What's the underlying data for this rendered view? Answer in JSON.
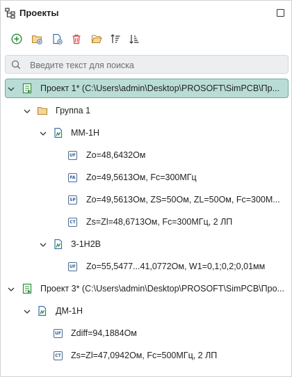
{
  "panel": {
    "title": "Проекты",
    "title_icon": "project-tree-icon",
    "maximize_icon": "maximize-icon"
  },
  "toolbar": {
    "buttons": [
      {
        "icon": "add-circle-icon",
        "color": "#2e8b3a"
      },
      {
        "icon": "new-folder-icon",
        "color": "#c79a3c"
      },
      {
        "icon": "new-file-icon",
        "color": "#3d6fb0"
      },
      {
        "icon": "delete-icon",
        "color": "#d64545"
      },
      {
        "icon": "open-folder-icon",
        "color": "#c79a3c"
      },
      {
        "icon": "sort-ascending-icon",
        "color": "#333333"
      },
      {
        "icon": "sort-descending-icon",
        "color": "#333333"
      }
    ]
  },
  "search": {
    "placeholder": "Введите текст для поиска"
  },
  "tree": {
    "rows": [
      {
        "text": "Проект 1* (C:\\Users\\admin\\Desktop\\PROSOFT\\SimPCB\\Пр...",
        "type": "project",
        "selected": true
      },
      {
        "text": "Группа 1",
        "type": "group"
      },
      {
        "text": "ММ-1Н",
        "type": "model"
      },
      {
        "text": "Zo=48,6432Ом",
        "type": "result",
        "badge": "UF"
      },
      {
        "text": "Zo=49,5613Ом, Fc=300МГц",
        "type": "result",
        "badge": "FA"
      },
      {
        "text": "Zo=49,5613Ом, ZS=50Ом, ZL=50Ом, Fc=300М...",
        "type": "result",
        "badge": "SP"
      },
      {
        "text": "Zs=Zl=48,6713Ом, Fc=300МГц, 2 ЛП",
        "type": "result",
        "badge": "CT"
      },
      {
        "text": "З-1Н2В",
        "type": "model"
      },
      {
        "text": "Zo=55,5477...41,0772Ом, W1=0,1;0,2;0,01мм",
        "type": "result",
        "badge": "UF"
      },
      {
        "text": "Проект 3* (C:\\Users\\admin\\Desktop\\PROSOFT\\SimPCB\\Про...",
        "type": "project"
      },
      {
        "text": "ДМ-1Н",
        "type": "model"
      },
      {
        "text": "Zdiff=94,1884Ом",
        "type": "result",
        "badge": "UF"
      },
      {
        "text": "Zs=Zl=47,0942Ом, Fc=500МГц, 2 ЛП",
        "type": "result",
        "badge": "CT"
      }
    ]
  },
  "colors": {
    "selection_bg": "#b9ddd6",
    "selection_border": "#6fa89d",
    "project_icon": "#2e8b3a",
    "model_icon": "#3d6fb0"
  }
}
